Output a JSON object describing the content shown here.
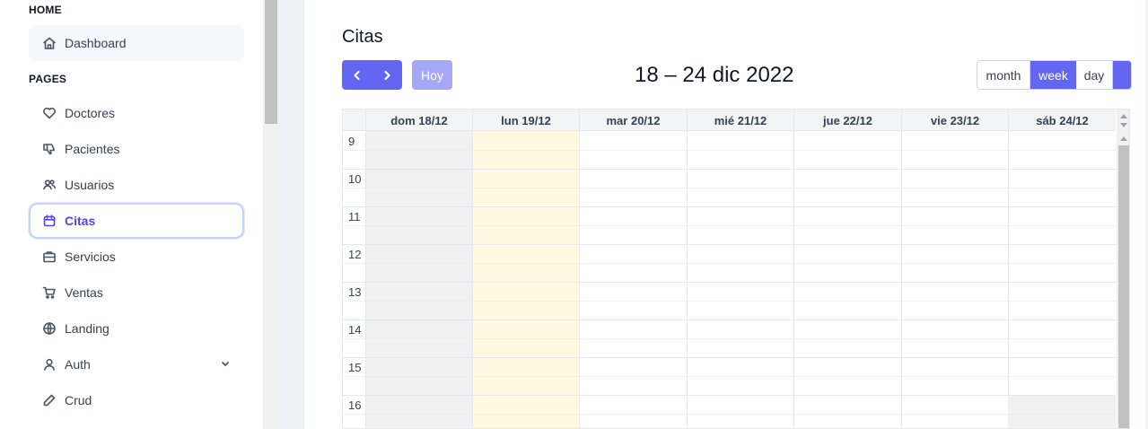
{
  "sidebar": {
    "home_title": "HOME",
    "pages_title": "PAGES",
    "dashboard": "Dashboard",
    "items": [
      {
        "label": "Doctores",
        "icon": "heart-icon"
      },
      {
        "label": "Pacientes",
        "icon": "thumbs-down-icon"
      },
      {
        "label": "Usuarios",
        "icon": "users-icon"
      },
      {
        "label": "Citas",
        "icon": "calendar-icon",
        "active": true
      },
      {
        "label": "Servicios",
        "icon": "briefcase-icon"
      },
      {
        "label": "Ventas",
        "icon": "cart-icon"
      },
      {
        "label": "Landing",
        "icon": "globe-icon"
      },
      {
        "label": "Auth",
        "icon": "user-icon",
        "expandable": true
      },
      {
        "label": "Crud",
        "icon": "pencil-icon"
      }
    ]
  },
  "main": {
    "title": "Citas",
    "today_label": "Hoy",
    "range_title": "18 – 24 dic 2022",
    "views": {
      "month": "month",
      "week": "week",
      "day": "day"
    },
    "active_view": "week",
    "days": [
      "dom 18/12",
      "lun 19/12",
      "mar 20/12",
      "mié 21/12",
      "jue 22/12",
      "vie 23/12",
      "sáb 24/12"
    ],
    "hours": [
      "9",
      "10",
      "11",
      "12",
      "13",
      "14",
      "15",
      "16"
    ]
  },
  "colors": {
    "accent": "#6366f1",
    "today_bg": "#fef9e0",
    "weekend_bg": "#f1f1f1"
  }
}
